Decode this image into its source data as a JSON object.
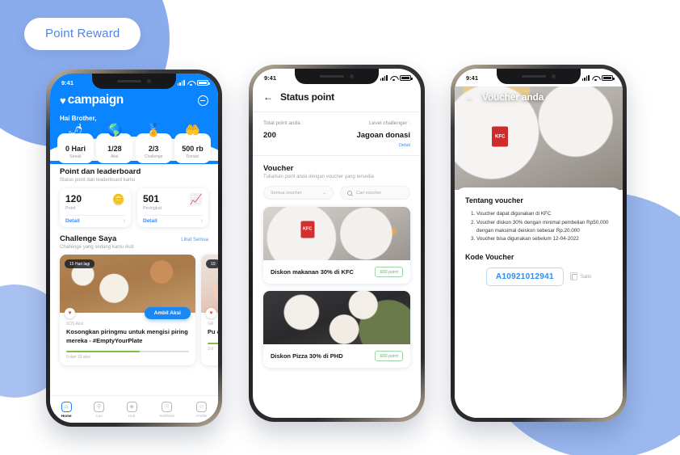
{
  "badge": {
    "label": "Point Reward"
  },
  "theme": {
    "brand_blue": "#0a84ff",
    "accent_blue": "#3d8ced",
    "bg_blue": "#9bb8ef",
    "green": "#7bc043",
    "point_green": "#5bb36a"
  },
  "phone1": {
    "status": {
      "time": "9:41"
    },
    "header": {
      "brand": "campaign",
      "heart_icon": "heart-icon",
      "chat_icon": "chat-icon",
      "greeting": "Hai Brother,"
    },
    "stats": [
      {
        "emoji": "🌶",
        "value": "0 Hari",
        "label": "Streak",
        "icon": "streak-flame-icon"
      },
      {
        "emoji": "🌎",
        "value": "1/28",
        "label": "Aksi",
        "icon": "globe-icon"
      },
      {
        "emoji": "🏅",
        "value": "2/3",
        "label": "Challenge",
        "icon": "medal-icon"
      },
      {
        "emoji": "🤲",
        "value": "500 rb",
        "label": "Donasi",
        "icon": "donation-hand-icon"
      }
    ],
    "point_section": {
      "title": "Point dan leaderboard",
      "subtitle": "Status point dan leaderboard kamu",
      "cards": [
        {
          "number": "120",
          "caption": "Point",
          "emoji": "🪙",
          "icon": "coins-icon",
          "detail": "Detail",
          "chevron": "›"
        },
        {
          "number": "501",
          "caption": "Peringkat",
          "emoji": "📈",
          "icon": "chart-up-icon",
          "detail": "Detail",
          "chevron": "›"
        }
      ]
    },
    "challenge_section": {
      "title": "Challenge Saya",
      "see_all": "Lihat Semua",
      "subtitle": "Challenge yang sedang kamu ikuti",
      "cards": [
        {
          "days": "15 Hari lagi",
          "action": "Ambil Aksi",
          "meta": "SOS Aksi",
          "title": "Kosongkan piringmu untuk mengisi piring mereka - #EmptyYourPlate",
          "progress_pct": 60,
          "progress_caption": "9 dari 15 aksi",
          "heart_icon": "heart-icon"
        },
        {
          "days": "10",
          "meta": "GR",
          "title": "Pu #",
          "progress_pct": 35,
          "progress_caption": "3 d",
          "heart_icon": "heart-icon"
        }
      ]
    },
    "tabs": [
      {
        "label": "Home",
        "icon": "home-icon",
        "glyph": "⌂",
        "active": true
      },
      {
        "label": "Cari",
        "icon": "search-icon",
        "glyph": "⚲",
        "active": false
      },
      {
        "label": "Hub",
        "icon": "hub-icon",
        "glyph": "⚙",
        "active": false
      },
      {
        "label": "Notifikasi",
        "icon": "bell-icon",
        "glyph": "⌂",
        "active": false
      },
      {
        "label": "Profile",
        "icon": "profile-icon",
        "glyph": "☺",
        "active": false
      }
    ]
  },
  "phone2": {
    "status": {
      "time": "9:41"
    },
    "header": {
      "back_icon": "back-arrow-icon",
      "title": "Status point"
    },
    "points": {
      "total_label": "Total point anda :",
      "total_value": "200",
      "level_label": "Level challenger :",
      "level_value": "Jagoan donasi",
      "detail": "Detail"
    },
    "voucher": {
      "title": "Voucher",
      "subtitle": "Tukarkan point anda dengan voucher yang tersedia",
      "filter_value": "Semua voucher",
      "filter_chevron": "⌄",
      "search_placeholder": "Cari voucher",
      "search_icon": "search-icon",
      "items": [
        {
          "name": "Diskon makanan 30% di KFC",
          "points": "600 point",
          "brand": "KFC"
        },
        {
          "name": "Diskon Pizza 30% di PHD",
          "points": "600 point",
          "brand": "PHD"
        }
      ]
    }
  },
  "phone3": {
    "status": {
      "time": "9:41"
    },
    "header": {
      "back_icon": "back-arrow-icon",
      "title": "Voucher anda"
    },
    "hero_brand": "KFC",
    "about": {
      "title": "Tentang voucher",
      "items": [
        "Voucher dapat digunakan di KFC",
        "Voucher diskon 30% dengan minimal pembelian Rp50.000 dengan maksimal deiskon sebesar Rp.20.000",
        "Voucher bisa digunakan sebelum 12-04-2022"
      ]
    },
    "code": {
      "title": "Kode Voucher",
      "value": "A10921012941",
      "copy_label": "Salin",
      "copy_icon": "copy-icon"
    }
  }
}
